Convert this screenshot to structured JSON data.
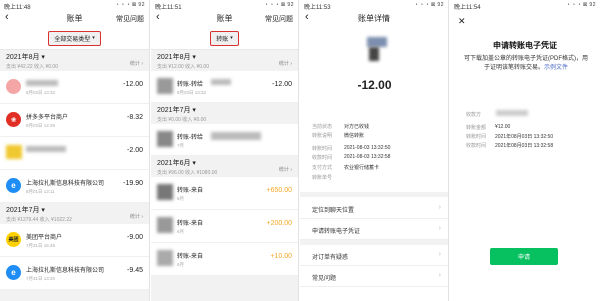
{
  "panel1": {
    "status_time": "晚上11:48",
    "status_icons": "◔ ◔ ◔ ⊠ 92",
    "title": "账单",
    "right": "常见问题",
    "filter": "全部交易类型",
    "month1": "2021年8月",
    "month1_sum": "支出 ¥42.22 收入 ¥0.00",
    "stats": "统计",
    "tx": [
      {
        "name": "",
        "date": "8月03日 13:32",
        "amount": "-12.00"
      },
      {
        "name": "拼多多平台商户",
        "date": "8月03日 12:29",
        "amount": "-8.32"
      },
      {
        "name": "",
        "date": "",
        "amount": "-2.00"
      },
      {
        "name": "上海拉扎斯信息科技有限公司",
        "date": "8月01日 13:11",
        "amount": "-19.90"
      }
    ],
    "month2": "2021年7月",
    "month2_sum": "支出 ¥1279.44 收入 ¥1022.22",
    "tx2": [
      {
        "name": "美团平台商户",
        "date": "7月31日 15:48",
        "amount": "-9.00"
      },
      {
        "name": "上海拉扎斯信息科技有限公司",
        "date": "7月31日 13:20",
        "amount": "-9.45"
      }
    ]
  },
  "panel2": {
    "status_time": "晚上11:51",
    "title": "账单",
    "right": "常见问题",
    "filter": "转账",
    "month1": "2021年8月",
    "month1_sum": "支出 ¥12.00 收入 ¥0.00",
    "stats": "统计",
    "tx1": [
      {
        "name": "转账-转给",
        "date": "8月03日 13:32",
        "amount": "-12.00"
      }
    ],
    "month2": "2021年7月",
    "month2_sum": "支出 ¥0.00 收入 ¥0.00",
    "tx2": [
      {
        "name": "转账-转给",
        "date": "7月",
        "amount": ""
      }
    ],
    "month3": "2021年6月",
    "month3_sum": "支出 ¥96.00 收入 ¥1080.00",
    "tx3": [
      {
        "name": "转账-来自",
        "date": "6月",
        "amount": "+650.00"
      },
      {
        "name": "转账-来自",
        "date": "6月",
        "amount": "+200.00"
      },
      {
        "name": "转账-来自",
        "date": "6月",
        "amount": "+10.00"
      }
    ]
  },
  "panel3": {
    "status_time": "晚上11:53",
    "title": "账单详情",
    "amount": "-12.00",
    "rows": [
      {
        "k": "当前状态",
        "v": "对方已收钱"
      },
      {
        "k": "转账说明",
        "v": "微信转账"
      },
      {
        "k": "转账时间",
        "v": "2021-08-03 13:32:50"
      },
      {
        "k": "收款时间",
        "v": "2021-08-03 13:32:58"
      },
      {
        "k": "支付方式",
        "v": "农业银行储蓄卡"
      },
      {
        "k": "转账单号",
        "v": ""
      }
    ],
    "actions": [
      "定位到聊天位置",
      "申请转账电子凭证",
      "对订单有疑惑",
      "常见问题"
    ]
  },
  "panel4": {
    "status_time": "晚上11:54",
    "title": "申请转账电子凭证",
    "desc": "可下载加盖公章的转账电子凭证(PDF格式)，用于证明该笔转账交易。",
    "link": "示例文件",
    "rows": [
      {
        "k": "收款方",
        "v": ""
      },
      {
        "k": "转账金额",
        "v": "¥12.00"
      },
      {
        "k": "转账时间",
        "v": "2021年08月03日 13:32:50"
      },
      {
        "k": "收款时间",
        "v": "2021年08月03日 13:32:58"
      }
    ],
    "button": "申请"
  }
}
